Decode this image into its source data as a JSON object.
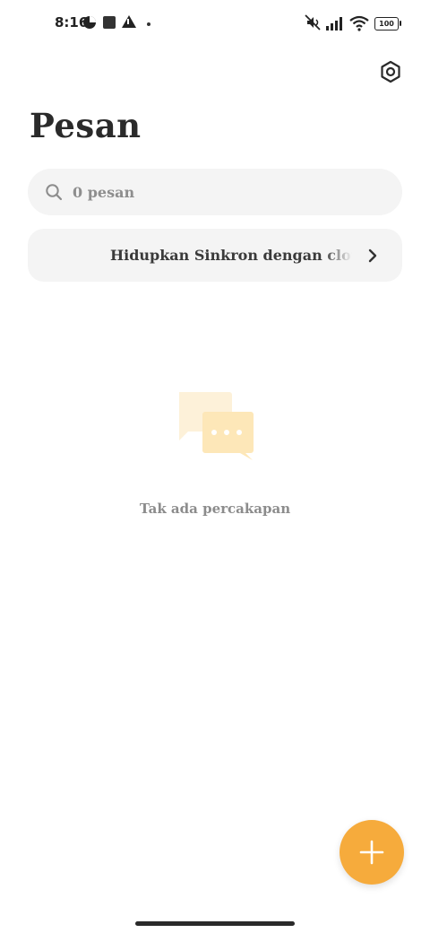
{
  "status_bar": {
    "time": "8:16",
    "battery": "100",
    "icons": [
      "data-saver-icon",
      "square-notification-icon",
      "alert-icon",
      "dot-icon",
      "mute-icon",
      "signal-icon",
      "wifi-icon",
      "battery-icon"
    ]
  },
  "header": {
    "title": "Pesan",
    "settings_icon": "settings-icon"
  },
  "search": {
    "placeholder": "0 pesan",
    "value": ""
  },
  "sync_banner": {
    "text": "Hidupkan Sinkron dengan cloud untuk"
  },
  "empty_state": {
    "message": "Tak ada percakapan"
  },
  "fab": {
    "icon": "plus-icon"
  },
  "colors": {
    "accent": "#f6ab3c",
    "surface": "#f4f4f4",
    "illustration": "#fde7b8"
  }
}
